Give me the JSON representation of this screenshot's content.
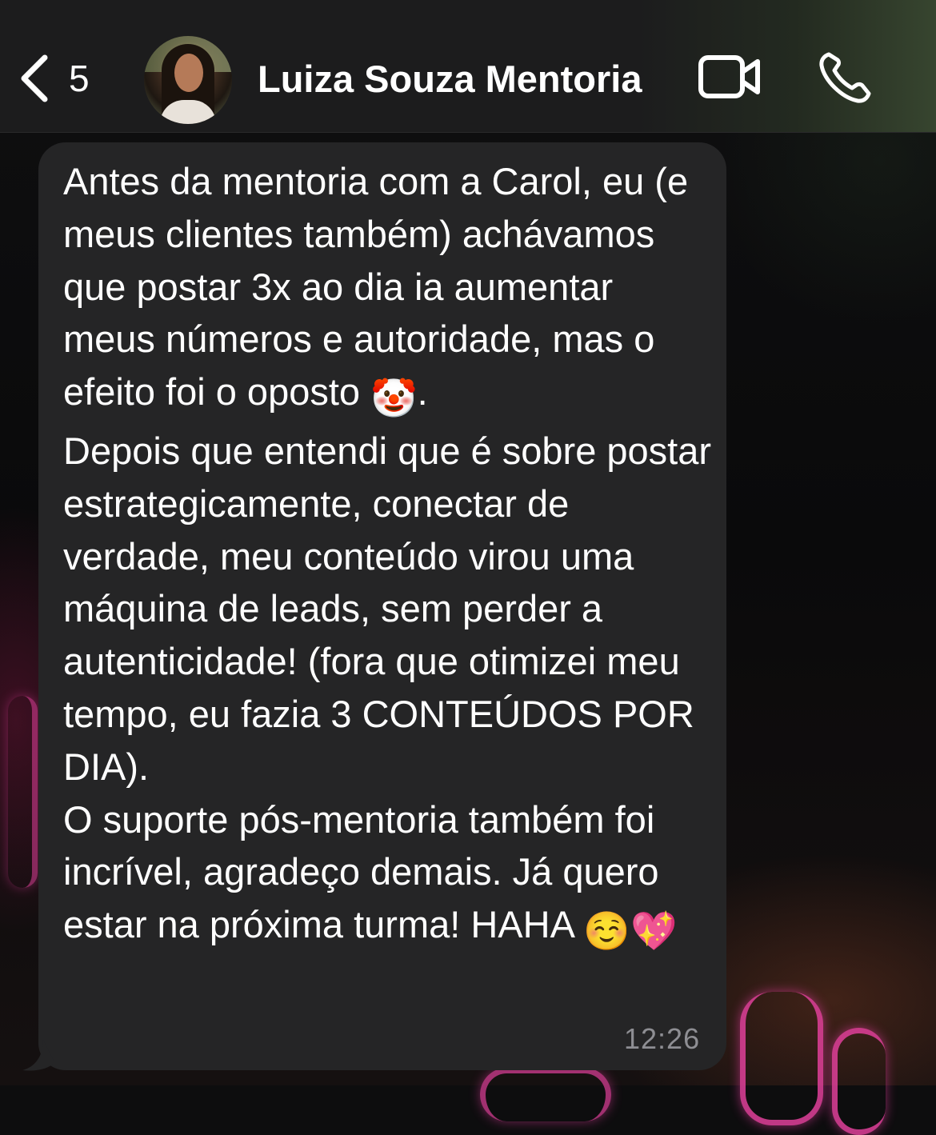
{
  "header": {
    "back_count": "5",
    "contact_name": "Luiza Souza Mentoria",
    "icons": {
      "back": "chevron-left-icon",
      "video": "video-camera-icon",
      "call": "phone-icon"
    }
  },
  "message": {
    "paragraph_1_a": "Antes da mentoria com a Carol, eu (e meus clientes também) achávamos que postar 3x ao dia ia aumentar meus números e autoridade, mas o efeito foi o oposto ",
    "emoji_clown": "🤡",
    "paragraph_1_b": ".",
    "paragraph_2": "Depois que entendi que é sobre postar estrategicamente, conectar de verdade, meu conteúdo virou uma máquina de leads, sem perder a autenticidade! (fora que otimizei meu tempo, eu fazia 3 CONTEÚDOS POR DIA).",
    "paragraph_3": "O suporte pós-mentoria também foi incrível, agradeço demais. Já quero estar na próxima turma! HAHA ",
    "emoji_smile": "☺️",
    "emoji_heart": "💖",
    "time": "12:26"
  },
  "colors": {
    "header_bg": "#1c1c1d",
    "bubble_bg": "#252526",
    "text": "#ffffff",
    "timestamp": "#8e8e93"
  }
}
